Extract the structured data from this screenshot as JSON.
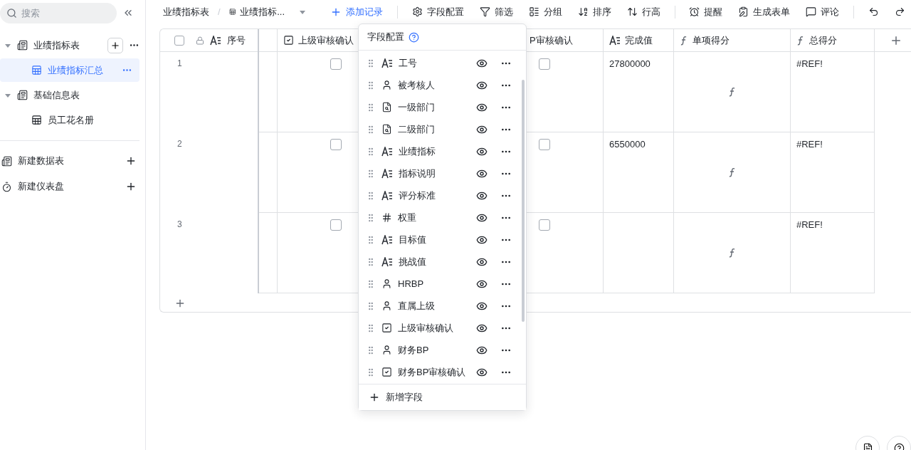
{
  "sidebar": {
    "search": {
      "placeholder": "搜索"
    },
    "tree": [
      {
        "label": "业绩指标表",
        "expanded": true,
        "children": [
          {
            "label": "业绩指标汇总",
            "selected": true
          }
        ]
      },
      {
        "label": "基础信息表",
        "expanded": true,
        "children": [
          {
            "label": "员工花名册",
            "selected": false
          }
        ]
      }
    ],
    "actions": [
      {
        "kind": "table",
        "label": "新建数据表"
      },
      {
        "kind": "dashboard",
        "label": "新建仪表盘"
      }
    ]
  },
  "toolbar": {
    "breadcrumb": [
      "业绩指标表",
      "业绩指标..."
    ],
    "separator": "/",
    "add_record": "添加记录",
    "groups": [
      [
        {
          "kind": "fields",
          "label": "字段配置"
        },
        {
          "kind": "filter",
          "label": "筛选"
        },
        {
          "kind": "group",
          "label": "分组"
        },
        {
          "kind": "sort",
          "label": "排序"
        },
        {
          "kind": "height",
          "label": "行高"
        }
      ],
      [
        {
          "kind": "remind",
          "label": "提醒"
        },
        {
          "kind": "form",
          "label": "生成表单"
        },
        {
          "kind": "comment",
          "label": "评论"
        }
      ]
    ]
  },
  "table": {
    "all_selected": false,
    "columns": [
      {
        "kind": "index",
        "label": "序号",
        "locked": true
      },
      {
        "kind": "spacer"
      },
      {
        "kind": "checkbox",
        "label": "上级审核确认"
      },
      {
        "kind": "cut",
        "label": "P审核确认"
      },
      {
        "kind": "text",
        "label": "完成值"
      },
      {
        "kind": "formula",
        "label": "单项得分"
      },
      {
        "kind": "formula",
        "label": "总得分"
      }
    ],
    "rows": [
      {
        "number": "1",
        "cells": [
          null,
          {
            "checked": false
          },
          {
            "checked": false
          },
          {
            "value": "27800000"
          },
          null,
          {
            "value": "#REF!"
          }
        ]
      },
      {
        "number": "2",
        "cells": [
          null,
          {
            "checked": false
          },
          {
            "checked": false
          },
          {
            "value": "6550000"
          },
          null,
          {
            "value": "#REF!"
          }
        ]
      },
      {
        "number": "3",
        "cells": [
          null,
          {
            "checked": false
          },
          {
            "checked": false
          },
          null,
          null,
          {
            "value": "#REF!"
          }
        ]
      }
    ]
  },
  "field_panel": {
    "title": "字段配置",
    "fields": [
      {
        "kind": "text",
        "label": "工号"
      },
      {
        "kind": "person",
        "label": "被考核人"
      },
      {
        "kind": "lookup",
        "label": "一级部门"
      },
      {
        "kind": "lookup",
        "label": "二级部门"
      },
      {
        "kind": "text",
        "label": "业绩指标"
      },
      {
        "kind": "text",
        "label": "指标说明"
      },
      {
        "kind": "text",
        "label": "评分标准"
      },
      {
        "kind": "number",
        "label": "权重"
      },
      {
        "kind": "text",
        "label": "目标值"
      },
      {
        "kind": "text",
        "label": "挑战值"
      },
      {
        "kind": "person",
        "label": "HRBP"
      },
      {
        "kind": "person",
        "label": "直属上级"
      },
      {
        "kind": "checkbox",
        "label": "上级审核确认"
      },
      {
        "kind": "person",
        "label": "财务BP"
      },
      {
        "kind": "checkbox",
        "label": "财务BP审核确认"
      }
    ],
    "add_field": "新增字段"
  }
}
